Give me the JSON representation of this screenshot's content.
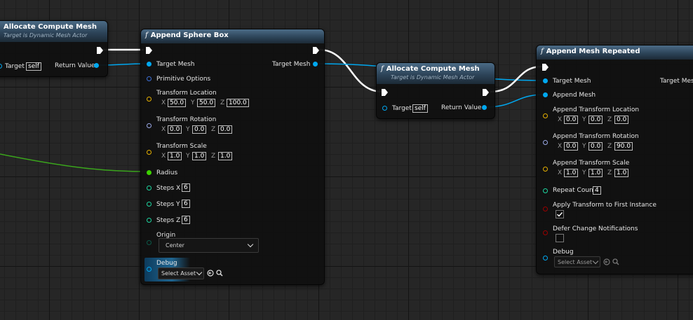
{
  "colors": {
    "exec": "#ffffff",
    "object": "#00a8f0",
    "struct": "#e5b000",
    "rotator": "#9aa8e6",
    "float": "#3cd100",
    "int": "#1ed6a0",
    "bool": "#9a0000",
    "wire_green": "#3aa51c"
  },
  "node_alloc_left": {
    "title": "Allocate Compute Mesh",
    "subtitle": "Target is Dynamic Mesh Actor",
    "target_label": "Target",
    "target_value": "self",
    "return_label": "Return Value"
  },
  "node_sphere": {
    "title": "Append Sphere Box",
    "target_mesh": "Target Mesh",
    "target_mesh_out": "Target Mesh",
    "primitive_options": "Primitive Options",
    "loc_label": "Transform Location",
    "loc": {
      "x": "50.0",
      "y": "50.0",
      "z": "100.0"
    },
    "rot_label": "Transform Rotation",
    "rot": {
      "x": "0.0",
      "y": "0.0",
      "z": "0.0"
    },
    "scale_label": "Transform Scale",
    "scale": {
      "x": "1.0",
      "y": "1.0",
      "z": "1.0"
    },
    "radius": "Radius",
    "steps_x": "Steps X",
    "steps_x_v": "6",
    "steps_y": "Steps Y",
    "steps_y_v": "6",
    "steps_z": "Steps Z",
    "steps_z_v": "6",
    "origin": "Origin",
    "origin_value": "Center",
    "debug": "Debug",
    "debug_value": "Select Asset"
  },
  "node_alloc_mid": {
    "title": "Allocate Compute Mesh",
    "subtitle": "Target is Dynamic Mesh Actor",
    "target_label": "Target",
    "target_value": "self",
    "return_label": "Return Value"
  },
  "node_repeat": {
    "title": "Append Mesh Repeated",
    "target_mesh": "Target Mesh",
    "target_mesh_out": "Target Mesh",
    "append_mesh": "Append Mesh",
    "loc_label": "Append Transform Location",
    "loc": {
      "x": "0.0",
      "y": "0.0",
      "z": "0.0"
    },
    "rot_label": "Append Transform Rotation",
    "rot": {
      "x": "0.0",
      "y": "0.0",
      "z": "90.0"
    },
    "scale_label": "Append Transform Scale",
    "scale": {
      "x": "1.0",
      "y": "1.0",
      "z": "1.0"
    },
    "repeat_count": "Repeat Count",
    "repeat_count_v": "4",
    "apply_first": "Apply Transform to First Instance",
    "defer": "Defer Change Notifications",
    "debug": "Debug",
    "debug_value": "Select Asset"
  },
  "axis": {
    "x": "X",
    "y": "Y",
    "z": "Z"
  }
}
